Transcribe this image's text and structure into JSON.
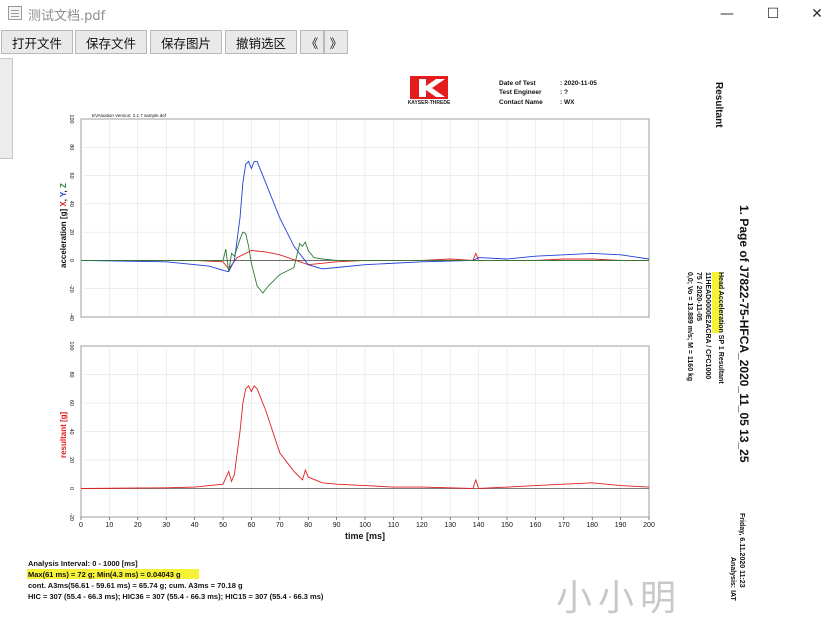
{
  "window": {
    "title": "测试文档.pdf",
    "minimize_symbol": "—",
    "maximize_symbol": "☐",
    "close_symbol": "✕"
  },
  "toolbar": {
    "open_label": "打开文件",
    "save_label": "保存文件",
    "save_image_label": "保存图片",
    "undo_selection_label": "撤销选区",
    "prev_label": "《",
    "next_label": "》"
  },
  "report": {
    "logo_text": "KAYSER-THREDE",
    "date_label": "Date of Test",
    "date_value": ": 2020-11-05",
    "engineer_label": "Test Engineer",
    "engineer_value": ": ?",
    "contact_label": "Contact Name",
    "contact_value": ": WX",
    "version_text": "EVAluation Version: 2.1.7 sample.def",
    "side_heading": "Resultant",
    "page_title": "1. Page of J7822-75-HFCA_2020_11_05 13_25",
    "meta_highlight": "Head Acceleration",
    "meta_line1_rest": " SP 1 Resultant",
    "meta_line2": "11HEAD0000E2ACRA / CFC1000",
    "meta_line3": "75 / 2020-11-05",
    "meta_line4": "0,0; Vo = 13.889 m/s; M = 1160 kg",
    "footer_date": "Friday, 6.11.2020   11:23",
    "footer_analysis": "Analysis: IAT",
    "analysis_interval": "Analysis Interval:  0 - 1000 [ms]",
    "max_text": "Max(61 ms) = 72 g",
    "min_text": "Min(4.3 ms) = 0.04043 g",
    "cont_text": "cont. A3ms(56.61 - 59.61 ms) = 65.74 g; cum. A3ms = 70.18 g",
    "hic_text": "HIC = 307 (55.4 - 66.3 ms); HIC36 = 307 (55.4 - 66.3 ms); HIC15 = 307 (55.4 - 66.3 ms)",
    "watermark": "小小明"
  },
  "chart_data": [
    {
      "type": "line",
      "ylabel_parts": [
        "acceleration [g]",
        "X",
        ",",
        "Y",
        ",",
        "Z"
      ],
      "xlim": [
        0,
        200
      ],
      "ylim": [
        -40,
        100
      ],
      "yticks": [
        100,
        80,
        60,
        40,
        20,
        0,
        -20,
        -40
      ],
      "grid": true,
      "series": [
        {
          "name": "X",
          "color": "#e02020",
          "x": [
            0,
            40,
            50,
            52,
            55,
            60,
            65,
            70,
            80,
            90,
            100,
            110,
            120,
            130,
            138,
            139,
            140,
            150,
            160,
            170,
            180,
            190,
            200
          ],
          "y": [
            0,
            0,
            -1,
            -6,
            2,
            7,
            6,
            4,
            -3,
            -1,
            0,
            0,
            0,
            1,
            0,
            5,
            0,
            0,
            0,
            1,
            1,
            0,
            0
          ]
        },
        {
          "name": "Y",
          "color": "#1f3fd8",
          "x": [
            0,
            30,
            45,
            50,
            52,
            54,
            56,
            57,
            58,
            59,
            60,
            61,
            62,
            65,
            70,
            75,
            80,
            85,
            90,
            100,
            120,
            138,
            140,
            150,
            160,
            170,
            180,
            190,
            200
          ],
          "y": [
            0,
            -1,
            -4,
            -7,
            -8,
            0,
            30,
            55,
            68,
            70,
            65,
            70,
            70,
            55,
            30,
            10,
            -3,
            -6,
            -5,
            -3,
            -1,
            0,
            2,
            1,
            3,
            4,
            5,
            4,
            1
          ]
        },
        {
          "name": "Z",
          "color": "#2e7a32",
          "x": [
            0,
            40,
            50,
            51,
            52,
            53,
            54,
            56,
            57,
            58,
            59,
            60,
            62,
            64,
            66,
            70,
            75,
            77,
            78,
            79,
            80,
            82,
            85,
            90,
            100,
            140,
            200
          ],
          "y": [
            0,
            0,
            0,
            8,
            -8,
            5,
            3,
            15,
            20,
            19,
            10,
            -2,
            -18,
            -23,
            -18,
            -10,
            -5,
            12,
            10,
            13,
            7,
            2,
            1,
            0,
            0,
            0,
            0
          ]
        }
      ]
    },
    {
      "type": "line",
      "ylabel": "resultant [g]",
      "xlabel": "time [ms]",
      "xlim": [
        0,
        200
      ],
      "ylim": [
        -20,
        100
      ],
      "xticks": [
        0,
        10,
        20,
        30,
        40,
        50,
        60,
        70,
        80,
        90,
        100,
        110,
        120,
        130,
        140,
        150,
        160,
        170,
        180,
        190,
        200
      ],
      "yticks": [
        100,
        80,
        60,
        40,
        20,
        0,
        -20
      ],
      "grid": true,
      "series": [
        {
          "name": "resultant",
          "color": "#e02020",
          "x": [
            0,
            30,
            40,
            50,
            52,
            53,
            54,
            56,
            57,
            58,
            59,
            60,
            61,
            62,
            65,
            70,
            75,
            78,
            79,
            80,
            85,
            90,
            100,
            110,
            120,
            138,
            139,
            140,
            150,
            160,
            170,
            180,
            190,
            200
          ],
          "y": [
            0,
            0.5,
            1,
            3,
            12,
            5,
            10,
            40,
            60,
            70,
            72,
            68,
            72,
            70,
            55,
            25,
            12,
            6,
            13,
            8,
            4,
            3,
            2,
            1,
            1,
            0,
            6,
            0,
            1,
            2,
            3,
            4,
            2,
            1
          ]
        }
      ]
    }
  ]
}
